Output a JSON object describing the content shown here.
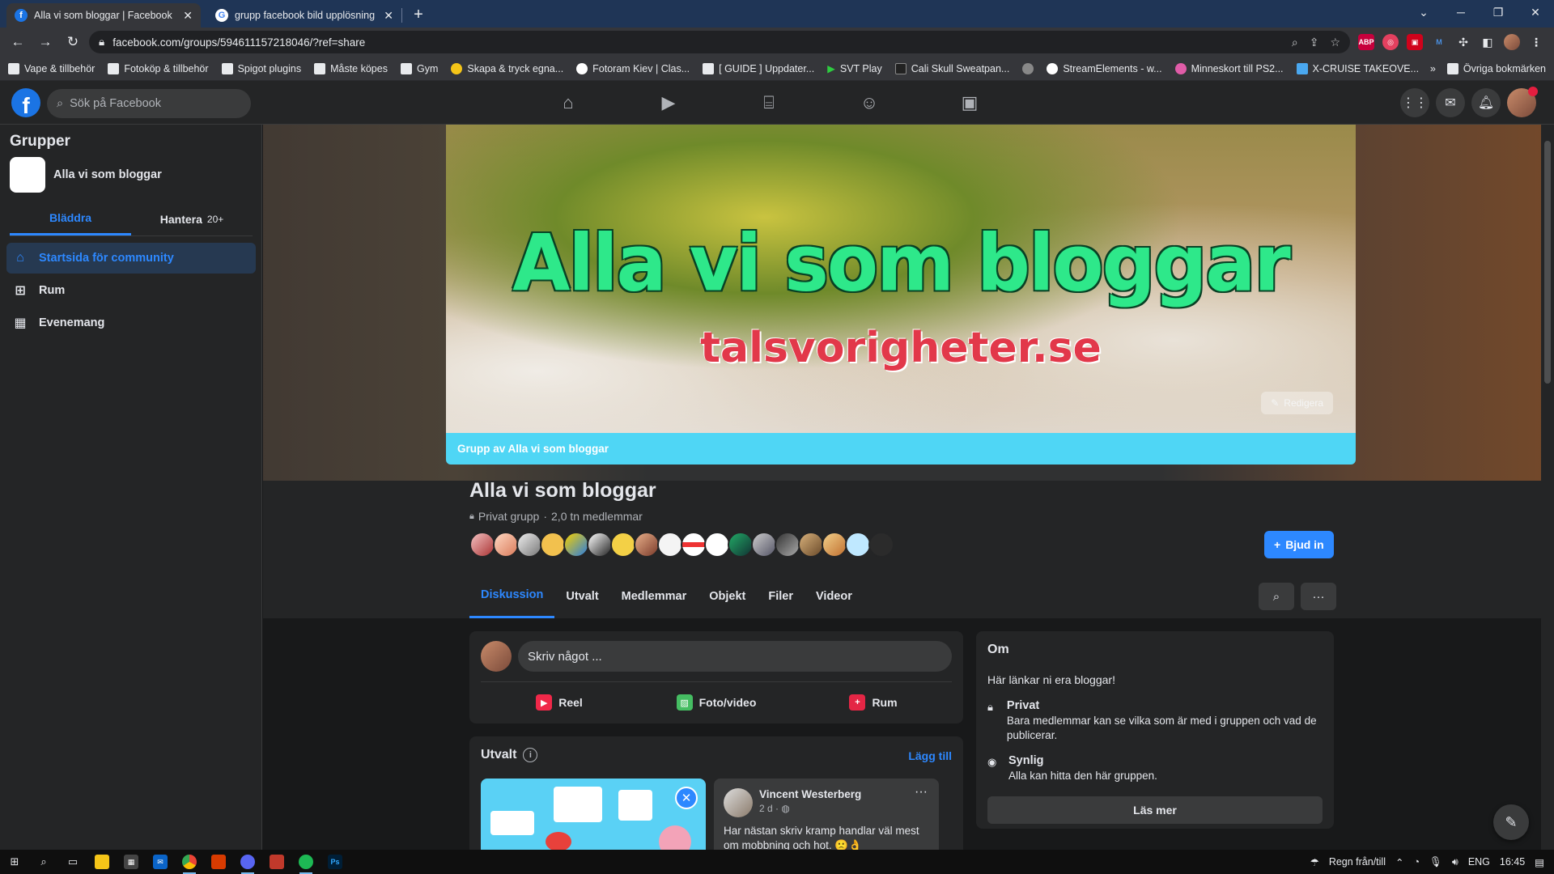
{
  "browser": {
    "tabs": [
      {
        "title": "Alla vi som bloggar | Facebook",
        "active": true
      },
      {
        "title": "grupp facebook bild upplösning",
        "active": false
      }
    ],
    "url": "facebook.com/groups/594611157218046/?ref=share",
    "bookmarks": [
      "Vape & tillbehör",
      "Fotoköp & tillbehör",
      "Spigot plugins",
      "Måste köpes",
      "Gym",
      "Skapa & tryck egna...",
      "Fotoram Kiev | Clas...",
      "[ GUIDE ] Uppdater...",
      "SVT Play",
      "Cali Skull Sweatpan...",
      "StreamElements - w...",
      "Minneskort till PS2...",
      "X-CRUISE TAKEOVE..."
    ],
    "bookmarks_more": "»",
    "other_bookmarks": "Övriga bokmärken",
    "extensions": [
      "ABP"
    ]
  },
  "fb": {
    "search_placeholder": "Sök på Facebook",
    "sidebar": {
      "title": "Grupper",
      "group_name": "Alla vi som bloggar",
      "tabs": [
        {
          "label": "Bläddra"
        },
        {
          "label": "Hantera",
          "count": "20+"
        }
      ],
      "items": [
        {
          "label": "Startsida för community",
          "icon": "home-icon"
        },
        {
          "label": "Rum",
          "icon": "rooms-icon"
        },
        {
          "label": "Evenemang",
          "icon": "events-icon"
        }
      ]
    },
    "cover": {
      "headline": "Alla vi som bloggar",
      "subline": "talsvorigheter.se",
      "edit_label": "Redigera",
      "banner": "Grupp av Alla vi som bloggar"
    },
    "group": {
      "title": "Alla vi som bloggar",
      "privacy": "Privat grupp",
      "members": "2,0 tn medlemmar",
      "invite": "Bjud in",
      "tabs": [
        "Diskussion",
        "Utvalt",
        "Medlemmar",
        "Objekt",
        "Filer",
        "Videor"
      ]
    },
    "composer": {
      "placeholder": "Skriv något ...",
      "actions": [
        "Reel",
        "Foto/video",
        "Rum"
      ]
    },
    "featured": {
      "title": "Utvalt",
      "add": "Lägg till",
      "post": {
        "author": "Vincent Westerberg",
        "time": "2 d ·",
        "text": "Har nästan skriv kramp handlar väl mest om mobbning och hot. 🙁👌"
      }
    },
    "about": {
      "title": "Om",
      "description": "Här länkar ni era bloggar!",
      "private_title": "Privat",
      "private_desc": "Bara medlemmar kan se vilka som är med i gruppen och vad de publicerar.",
      "visible_title": "Synlig",
      "visible_desc": "Alla kan hitta den här gruppen.",
      "more": "Läs mer"
    }
  },
  "taskbar": {
    "weather": "Regn från/till",
    "lang": "ENG",
    "time": "16:45"
  },
  "colors": {
    "fb_blue": "#2d88ff",
    "banner": "#4fd6f5",
    "cover_title": "#2ee88a",
    "cover_sub": "#e2384a"
  }
}
